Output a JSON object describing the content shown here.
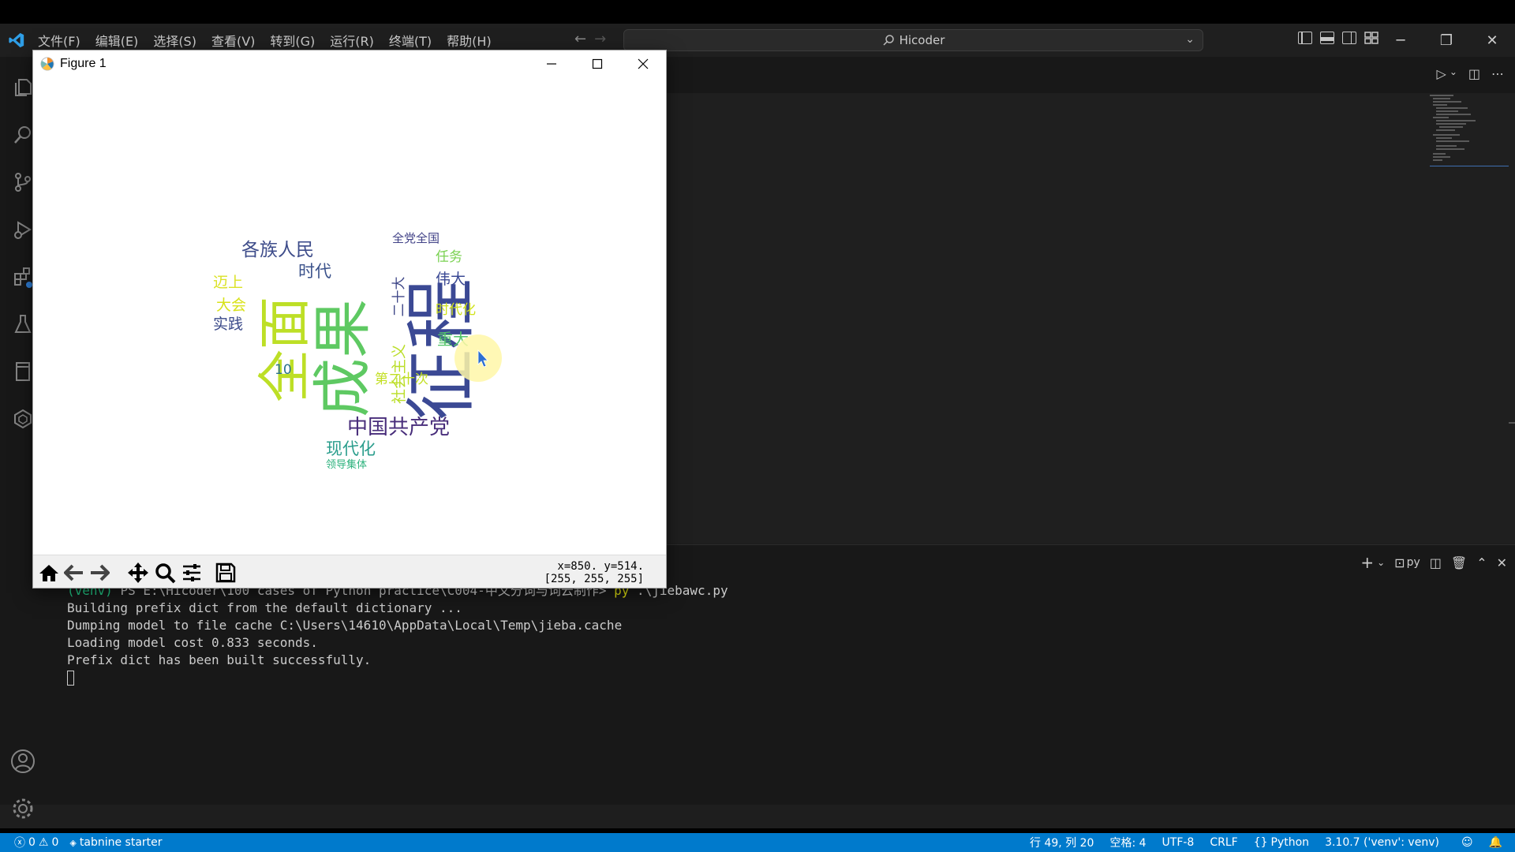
{
  "vscode": {
    "menu": [
      "文件(F)",
      "编辑(E)",
      "选择(S)",
      "查看(V)",
      "转到(G)",
      "运行(R)",
      "终端(T)",
      "帮助(H)"
    ],
    "search_text": "Hicoder",
    "accent_color": "#007acc"
  },
  "terminal": {
    "prompt_venv": "(venv)",
    "prompt_path": "PS E:\\Hicoder\\100 cases of Python practice\\C004-中文分词与词云制作>",
    "command": "py",
    "command_arg": " .\\jiebawc.py",
    "lines": [
      "Building prefix dict from the default dictionary ...",
      "Dumping model to file cache C:\\Users\\14610\\AppData\\Local\\Temp\\jieba.cache",
      "Loading model cost 0.833 seconds.",
      "Prefix dict has been built successfully."
    ]
  },
  "statusbar": {
    "errors": "0",
    "warnings": "0",
    "tabnine": "tabnine starter",
    "position": "行 49, 列 20",
    "spaces": "空格: 4",
    "encoding": "UTF-8",
    "eol": "CRLF",
    "language": "Python",
    "interpreter": "3.10.7 ('venv': venv)"
  },
  "figure": {
    "title": "Figure 1",
    "coords_line1": "x=850. y=514.",
    "coords_line2": "[255, 255, 255]",
    "words": [
      {
        "text": "征程",
        "color": "#3b4994"
      },
      {
        "text": "成果",
        "color": "#5ec962"
      },
      {
        "text": "全面",
        "color": "#bddf26"
      },
      {
        "text": "中国共产党",
        "color": "#472c7a"
      },
      {
        "text": "现代化",
        "color": "#2a9d8c"
      },
      {
        "text": "各族人民",
        "color": "#3e4c8a"
      },
      {
        "text": "时代",
        "color": "#3b528b"
      },
      {
        "text": "迈上",
        "color": "#dbe225"
      },
      {
        "text": "大会",
        "color": "#d8e219"
      },
      {
        "text": "实践",
        "color": "#3b4a8a"
      },
      {
        "text": "全党全国",
        "color": "#414287"
      },
      {
        "text": "任务",
        "color": "#7ad151"
      },
      {
        "text": "伟大",
        "color": "#3b4994"
      },
      {
        "text": "时代化",
        "color": "#d0e11c"
      },
      {
        "text": "重大",
        "color": "#52c569"
      },
      {
        "text": "第二十次",
        "color": "#c2df23"
      },
      {
        "text": "二十大",
        "color": "#3f4788"
      },
      {
        "text": "社会主义",
        "color": "#bade28"
      },
      {
        "text": "10",
        "color": "#2c728e"
      },
      {
        "text": "领导集体",
        "color": "#2db27d"
      }
    ]
  }
}
